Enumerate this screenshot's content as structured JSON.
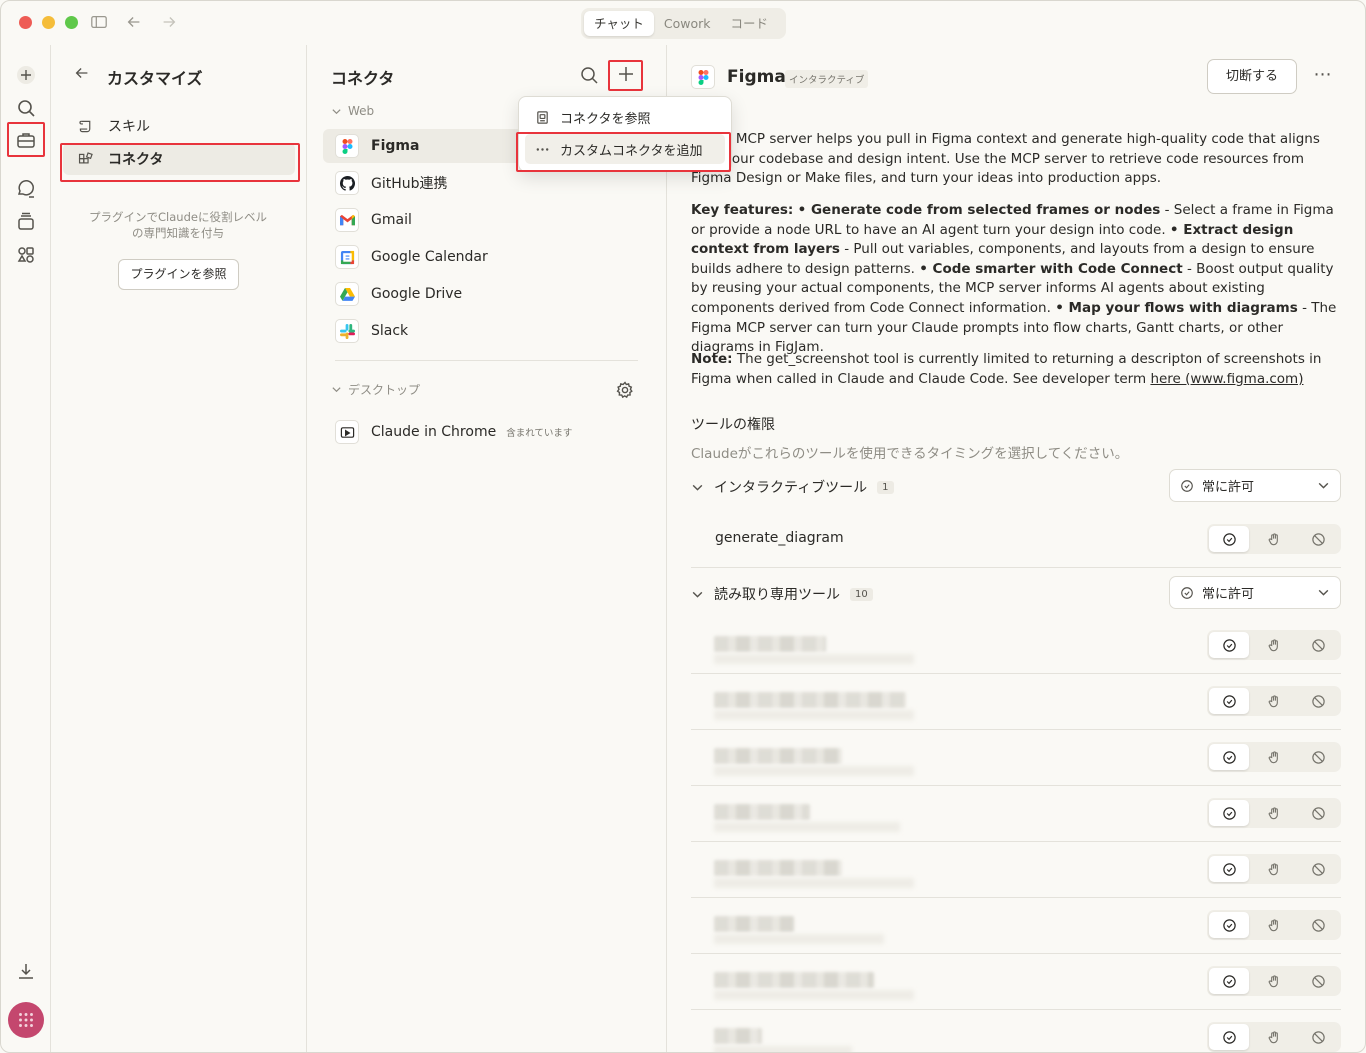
{
  "tabs": {
    "chat": "チャット",
    "cowork": "Cowork",
    "code": "コード"
  },
  "customize": {
    "title": "カスタマイズ",
    "skills": "スキル",
    "connectors": "コネクタ",
    "plugin_note": "プラグインでClaudeに役割レベルの専門知識を付与",
    "plugin_button": "プラグインを参照"
  },
  "connectors": {
    "title": "コネクタ",
    "web_section": "Web",
    "web_items": [
      "Figma",
      "GitHub連携",
      "Gmail",
      "Google Calendar",
      "Google Drive",
      "Slack"
    ],
    "desktop_section": "デスクトップ",
    "desktop_item": "Claude in Chrome",
    "desktop_tag": "含まれています"
  },
  "menu": {
    "browse": "コネクタを参照",
    "add_custom": "カスタムコネクタを追加"
  },
  "detail": {
    "name": "Figma",
    "badge": "インタラクティブ",
    "disconnect": "切断する",
    "desc1": "Figma MCP server helps you pull in Figma context and generate high-quality code that aligns with your codebase and design intent. Use the MCP server to retrieve code resources from Figma Design or Make files, and turn your ideas into production apps.",
    "kf_label": "Key features:",
    "kf1_title": "• Generate code from selected frames or nodes",
    "kf1_text": " - Select a frame in Figma or provide a node URL to have an AI agent turn your design into code. ",
    "kf2_title": "• Extract design context from layers",
    "kf2_text": " - Pull out variables, components, and layouts from a design to ensure builds adhere to design patterns. ",
    "kf3_title": "• Code smarter with Code Connect",
    "kf3_text": " - Boost output quality by reusing your actual components, the MCP server informs AI agents about existing components derived from Code Connect information. ",
    "kf4_title": "• Map your flows with diagrams",
    "kf4_text": " - The Figma MCP server can turn your Claude prompts into flow charts, Gantt charts, or other diagrams in FigJam.",
    "note_label": "Note:",
    "note_text": " The get_screenshot tool is currently limited to returning a descripton of screenshots in Figma when called in Claude and Claude Code. See developer term ",
    "note_link": "here (www.figma.com)",
    "perm_title": "ツールの権限",
    "perm_sub": "Claudeがこれらのツールを使用できるタイミングを選択してください。",
    "group1": {
      "name": "インタラクティブツール",
      "count": "1",
      "select": "常に許可",
      "tools": [
        "generate_diagram"
      ]
    },
    "group2": {
      "name": "読み取り専用ツール",
      "count": "10",
      "select": "常に許可"
    }
  }
}
